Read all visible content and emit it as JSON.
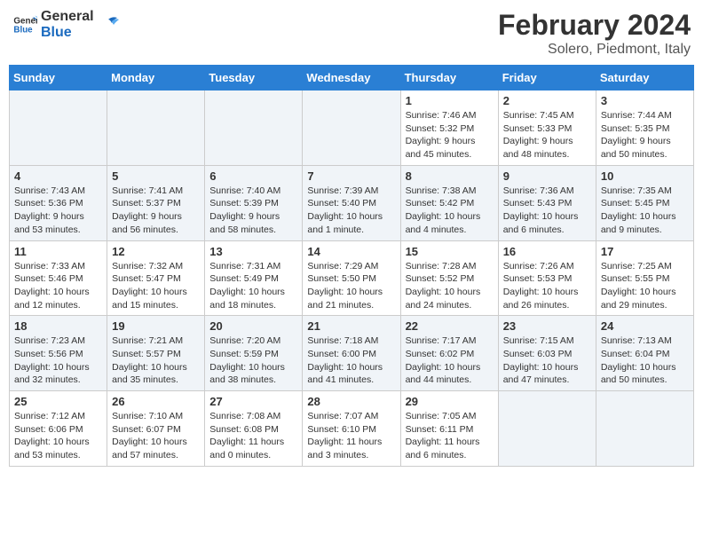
{
  "header": {
    "logo_line1": "General",
    "logo_line2": "Blue",
    "title": "February 2024",
    "subtitle": "Solero, Piedmont, Italy"
  },
  "days_of_week": [
    "Sunday",
    "Monday",
    "Tuesday",
    "Wednesday",
    "Thursday",
    "Friday",
    "Saturday"
  ],
  "weeks": [
    [
      {
        "day": "",
        "info": ""
      },
      {
        "day": "",
        "info": ""
      },
      {
        "day": "",
        "info": ""
      },
      {
        "day": "",
        "info": ""
      },
      {
        "day": "1",
        "info": "Sunrise: 7:46 AM\nSunset: 5:32 PM\nDaylight: 9 hours\nand 45 minutes."
      },
      {
        "day": "2",
        "info": "Sunrise: 7:45 AM\nSunset: 5:33 PM\nDaylight: 9 hours\nand 48 minutes."
      },
      {
        "day": "3",
        "info": "Sunrise: 7:44 AM\nSunset: 5:35 PM\nDaylight: 9 hours\nand 50 minutes."
      }
    ],
    [
      {
        "day": "4",
        "info": "Sunrise: 7:43 AM\nSunset: 5:36 PM\nDaylight: 9 hours\nand 53 minutes."
      },
      {
        "day": "5",
        "info": "Sunrise: 7:41 AM\nSunset: 5:37 PM\nDaylight: 9 hours\nand 56 minutes."
      },
      {
        "day": "6",
        "info": "Sunrise: 7:40 AM\nSunset: 5:39 PM\nDaylight: 9 hours\nand 58 minutes."
      },
      {
        "day": "7",
        "info": "Sunrise: 7:39 AM\nSunset: 5:40 PM\nDaylight: 10 hours\nand 1 minute."
      },
      {
        "day": "8",
        "info": "Sunrise: 7:38 AM\nSunset: 5:42 PM\nDaylight: 10 hours\nand 4 minutes."
      },
      {
        "day": "9",
        "info": "Sunrise: 7:36 AM\nSunset: 5:43 PM\nDaylight: 10 hours\nand 6 minutes."
      },
      {
        "day": "10",
        "info": "Sunrise: 7:35 AM\nSunset: 5:45 PM\nDaylight: 10 hours\nand 9 minutes."
      }
    ],
    [
      {
        "day": "11",
        "info": "Sunrise: 7:33 AM\nSunset: 5:46 PM\nDaylight: 10 hours\nand 12 minutes."
      },
      {
        "day": "12",
        "info": "Sunrise: 7:32 AM\nSunset: 5:47 PM\nDaylight: 10 hours\nand 15 minutes."
      },
      {
        "day": "13",
        "info": "Sunrise: 7:31 AM\nSunset: 5:49 PM\nDaylight: 10 hours\nand 18 minutes."
      },
      {
        "day": "14",
        "info": "Sunrise: 7:29 AM\nSunset: 5:50 PM\nDaylight: 10 hours\nand 21 minutes."
      },
      {
        "day": "15",
        "info": "Sunrise: 7:28 AM\nSunset: 5:52 PM\nDaylight: 10 hours\nand 24 minutes."
      },
      {
        "day": "16",
        "info": "Sunrise: 7:26 AM\nSunset: 5:53 PM\nDaylight: 10 hours\nand 26 minutes."
      },
      {
        "day": "17",
        "info": "Sunrise: 7:25 AM\nSunset: 5:55 PM\nDaylight: 10 hours\nand 29 minutes."
      }
    ],
    [
      {
        "day": "18",
        "info": "Sunrise: 7:23 AM\nSunset: 5:56 PM\nDaylight: 10 hours\nand 32 minutes."
      },
      {
        "day": "19",
        "info": "Sunrise: 7:21 AM\nSunset: 5:57 PM\nDaylight: 10 hours\nand 35 minutes."
      },
      {
        "day": "20",
        "info": "Sunrise: 7:20 AM\nSunset: 5:59 PM\nDaylight: 10 hours\nand 38 minutes."
      },
      {
        "day": "21",
        "info": "Sunrise: 7:18 AM\nSunset: 6:00 PM\nDaylight: 10 hours\nand 41 minutes."
      },
      {
        "day": "22",
        "info": "Sunrise: 7:17 AM\nSunset: 6:02 PM\nDaylight: 10 hours\nand 44 minutes."
      },
      {
        "day": "23",
        "info": "Sunrise: 7:15 AM\nSunset: 6:03 PM\nDaylight: 10 hours\nand 47 minutes."
      },
      {
        "day": "24",
        "info": "Sunrise: 7:13 AM\nSunset: 6:04 PM\nDaylight: 10 hours\nand 50 minutes."
      }
    ],
    [
      {
        "day": "25",
        "info": "Sunrise: 7:12 AM\nSunset: 6:06 PM\nDaylight: 10 hours\nand 53 minutes."
      },
      {
        "day": "26",
        "info": "Sunrise: 7:10 AM\nSunset: 6:07 PM\nDaylight: 10 hours\nand 57 minutes."
      },
      {
        "day": "27",
        "info": "Sunrise: 7:08 AM\nSunset: 6:08 PM\nDaylight: 11 hours\nand 0 minutes."
      },
      {
        "day": "28",
        "info": "Sunrise: 7:07 AM\nSunset: 6:10 PM\nDaylight: 11 hours\nand 3 minutes."
      },
      {
        "day": "29",
        "info": "Sunrise: 7:05 AM\nSunset: 6:11 PM\nDaylight: 11 hours\nand 6 minutes."
      },
      {
        "day": "",
        "info": ""
      },
      {
        "day": "",
        "info": ""
      }
    ]
  ]
}
